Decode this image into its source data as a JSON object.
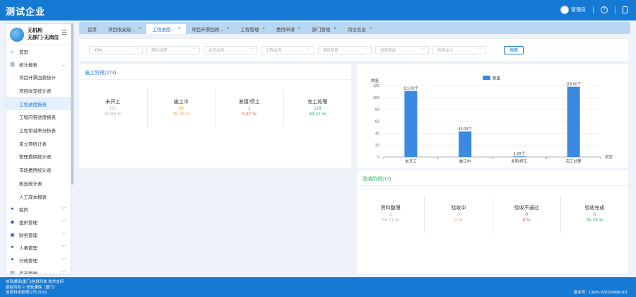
{
  "app": {
    "title": "测试企业"
  },
  "user": {
    "name": "管理员",
    "help": "?"
  },
  "org": {
    "line1": "无机构",
    "line2": "无部门-无岗位"
  },
  "nav": {
    "home": "首页",
    "stats": "统计报表",
    "sub_items": [
      "项目开票回款统计",
      "项目收支统计表",
      "工程进度报表",
      "工程内容进度报表",
      "工程审减率分析表",
      "未立项统计表",
      "管理费用统计表",
      "市场费用统计表",
      "收支统计表",
      "人工成本报表"
    ],
    "groups": [
      "我的",
      "组织管理",
      "财务管理",
      "人事管理",
      "行政管理",
      "资产管理"
    ]
  },
  "tabs": [
    "首页",
    "项目收支统...",
    "工程进度...",
    "项目开票回款...",
    "工程管理",
    "费用申请",
    "部门管理",
    "岗位信息"
  ],
  "filters": {
    "placeholders": [
      "机构",
      "项目经理",
      "合同名称",
      "工程名称",
      "项目阶段",
      "进度筛选",
      "特殊关注"
    ],
    "search": "搜索"
  },
  "construction": {
    "title": "施工阶段(273)",
    "stats": [
      {
        "label": "未开工",
        "count": "111",
        "pct": "40.66 %",
        "color": "#b5b5b5"
      },
      {
        "label": "施工中",
        "count": "43",
        "pct": "15.75 %",
        "color": "#f0a03c"
      },
      {
        "label": "发阻/停工",
        "count": "1",
        "pct": "0.37 %",
        "color": "#e84c3d"
      },
      {
        "label": "完工处理",
        "count": "118",
        "pct": "43.22 %",
        "color": "#29b060"
      }
    ]
  },
  "acceptance": {
    "title": "验收阶段(17)",
    "stats": [
      {
        "label": "资料整理",
        "count": "11",
        "pct": "64.71 %",
        "color": "#b5b5b5"
      },
      {
        "label": "验收中",
        "count": "0",
        "pct": "0 %",
        "color": "#f0a03c"
      },
      {
        "label": "验收不通过",
        "count": "0",
        "pct": "0 %",
        "color": "#e84c3d"
      },
      {
        "label": "验收完成",
        "count": "6",
        "pct": "35.29 %",
        "color": "#29b060"
      }
    ]
  },
  "chart_data": {
    "type": "bar",
    "categories": [
      "未开工",
      "施工中",
      "发阻/停工",
      "完工处理"
    ],
    "series": [
      {
        "name": "数量",
        "values": [
          111,
          43,
          1,
          118
        ]
      }
    ],
    "data_labels": [
      "111.00个",
      "43.00个",
      "1.00个",
      "118.00个"
    ],
    "ylabel": "数量",
    "xlabel": "类型",
    "ylim": [
      0,
      120
    ],
    "yticks": [
      0,
      20,
      40,
      60,
      80,
      100,
      120
    ],
    "color": "#3b89e0",
    "grid": true,
    "legend": "top-center"
  },
  "footer": {
    "line1": "信软通保(厦门)信息科技 技术支持",
    "line2": "版权所有 © 信软通保（厦门）",
    "line3": "信息科技有限公司 2019",
    "version": "版本号：CIMS-V20220808.v01"
  }
}
